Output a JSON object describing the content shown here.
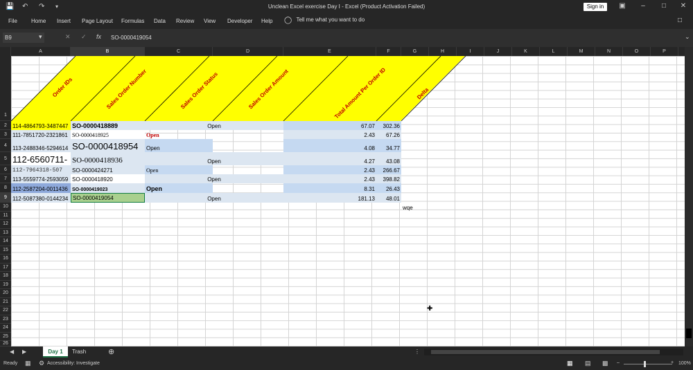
{
  "titlebar": {
    "title": "Unclean Excel exercise Day I  -  Excel (Product Activation Failed)",
    "sign_in": "Sign in"
  },
  "ribbon": {
    "tabs": [
      "File",
      "Home",
      "Insert",
      "Page Layout",
      "Formulas",
      "Data",
      "Review",
      "View",
      "Developer",
      "Help"
    ],
    "tell_me": "Tell me what you want to do"
  },
  "formula_bar": {
    "name_box": "B9",
    "fx": "fx",
    "value": "SO-0000419054"
  },
  "columns": [
    "A",
    "B",
    "C",
    "D",
    "E",
    "F",
    "G",
    "H",
    "I",
    "J",
    "K",
    "L",
    "M",
    "N",
    "O",
    "P"
  ],
  "rows": [
    "1",
    "2",
    "3",
    "4",
    "5",
    "6",
    "7",
    "8",
    "9",
    "10",
    "11",
    "12",
    "13",
    "14",
    "15",
    "16",
    "17",
    "18",
    "19",
    "20",
    "21",
    "22",
    "23",
    "24",
    "25",
    "26"
  ],
  "headers": {
    "order_ids": "Order IDs",
    "sales_order_number": "Sales Order Number",
    "sales_order_status": "Sales Order Status",
    "sales_order_amount": "Sales Order Amount",
    "total_amount": "Total Amount Per Order ID",
    "delta": "Delta"
  },
  "table": [
    {
      "order_id": "114-4864793-3487447",
      "so": "SO-0000418889",
      "status": "Open",
      "amount": "67.07",
      "delta": "302.36"
    },
    {
      "order_id": "111-7851720-2321861",
      "so": "SO-0000418925",
      "status": "Open",
      "amount": "2.43",
      "delta": "67.26"
    },
    {
      "order_id": "113-2488346-5294614",
      "so": "SO-0000418954",
      "status": "Open",
      "amount": "4.08",
      "delta": "34.77"
    },
    {
      "order_id": "112-6560711-",
      "so": "SO-0000418936",
      "status": "Open",
      "amount": "4.27",
      "delta": "43.08"
    },
    {
      "order_id": "112-7964318-507",
      "so": "SO-0000424271",
      "status": "Open",
      "amount": "2.43",
      "delta": "266.67"
    },
    {
      "order_id": "113-5559774-2593059",
      "so": "SO-0000418920",
      "status": "Open",
      "amount": "2.43",
      "delta": "398.82"
    },
    {
      "order_id": "112-2587204-0011436",
      "so": "SO-0000419023",
      "status": "Open",
      "amount": "8.31",
      "delta": "26.43"
    },
    {
      "order_id": "112-5087380-0144234",
      "so": "SO-0000419054",
      "status": "Open",
      "amount": "181.13",
      "delta": "48.01"
    }
  ],
  "stray_text": "wqe",
  "sheets": {
    "active": "Day 1",
    "other": "Trash"
  },
  "status": {
    "ready": "Ready",
    "accessibility": "Accessibility: Investigate",
    "zoom": "100%"
  },
  "colors": {
    "header_yellow": "#ffff00",
    "header_text": "#c00000",
    "selected_green": "#a9d08e"
  }
}
